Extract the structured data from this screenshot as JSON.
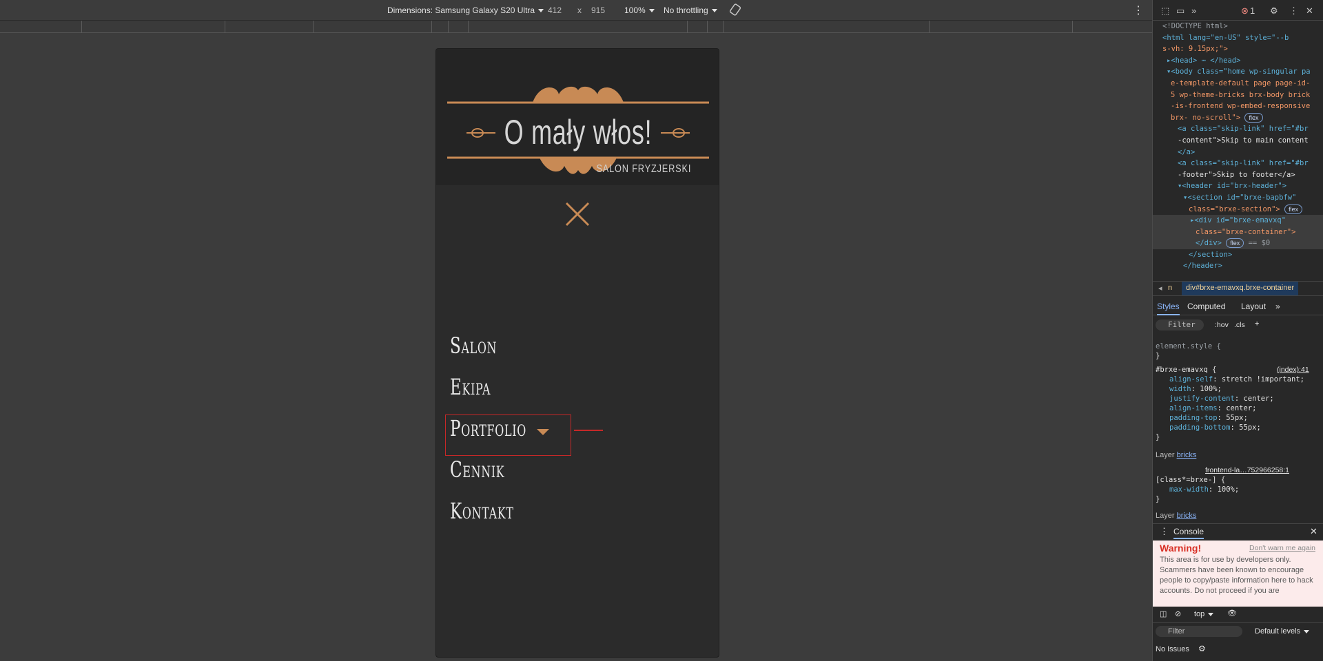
{
  "device_toolbar": {
    "dimensions_label": "Dimensions: Samsung Galaxy S20 Ultra",
    "width": "412",
    "times": "x",
    "height": "915",
    "zoom": "100%",
    "throttling": "No throttling"
  },
  "site": {
    "logo_title": "O mały włos!",
    "logo_subtitle": "SALON FRYZJERSKI",
    "menu": [
      {
        "label": "Salon"
      },
      {
        "label": "Ekipa"
      },
      {
        "label": "Portfolio"
      },
      {
        "label": "Cennik"
      },
      {
        "label": "Kontakt"
      }
    ],
    "accent_color": "#c88a55",
    "highlight_color": "#c62828"
  },
  "devtools": {
    "error_count": "1",
    "elements_lines": [
      "<!DOCTYPE html>",
      "<html lang=\"en-US\" style=\"--b",
      "s-vh: 9.15px;\">",
      "▸<head> ⋯ </head>",
      "▾<body class=\"home wp-singular pa",
      "e-template-default page page-id-",
      "5 wp-theme-bricks brx-body brick",
      "-is-frontend wp-embed-responsive",
      "brx- no-scroll\">",
      "<a class=\"skip-link\" href=\"#br",
      "-content\">Skip to main content",
      "</a>",
      "<a class=\"skip-link\" href=\"#br",
      "-footer\">Skip to footer</a>",
      "▾<header id=\"brx-header\">",
      "▾<section id=\"brxe-bapbfw\"",
      "class=\"brxe-section\">",
      "▸<div id=\"brxe-emavxq\"",
      "class=\"brxe-container\">",
      "</div>",
      "</section>",
      "</header>"
    ],
    "breadcrumb_prefix": "n",
    "breadcrumb_current": "div#brxe-emavxq.brxe-container",
    "flex_badge": "flex",
    "equals_sel": "== $0",
    "tabs": [
      "Styles",
      "Computed",
      "Layout"
    ],
    "filter_placeholder": "Filter",
    "hov": ":hov",
    "cls": ".cls",
    "styles": {
      "element_style": "element.style {",
      "close_brace": "}",
      "rule_selector": "#brxe-emavxq {",
      "rule_source": "(index):41",
      "props": [
        [
          "align-self",
          "stretch !important;"
        ],
        [
          "width",
          "100%;"
        ],
        [
          "justify-content",
          "center;"
        ],
        [
          "align-items",
          "center;"
        ],
        [
          "padding-top",
          "55px;"
        ],
        [
          "padding-bottom",
          "55px;"
        ]
      ],
      "layer_label": "Layer",
      "layer_name": "bricks",
      "rule2_source": "frontend-la…752966258:1",
      "rule2_selector": "[class*=brxe-] {",
      "rule2_prop": "max-width",
      "rule2_val": "100%;"
    },
    "console": {
      "tab": "Console",
      "warning_title": "Warning!",
      "dont_warn": "Don't warn me again",
      "warning_text": "This area is for use by developers only. Scammers have been known to encourage people to copy/paste information here to hack accounts. Do not proceed if you are",
      "context": "top",
      "filter": "Filter",
      "levels": "Default levels",
      "issues": "No Issues"
    }
  }
}
